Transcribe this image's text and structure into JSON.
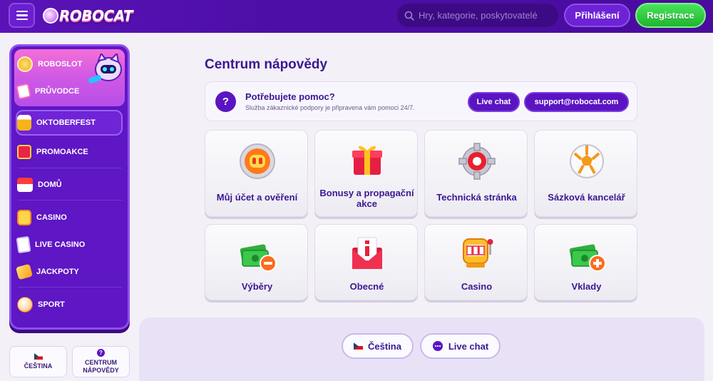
{
  "brand": {
    "logo_text": "ROBOCAT"
  },
  "header": {
    "search_placeholder": "Hry, kategorie, poskytovatelé",
    "login_label": "Přihlášení",
    "register_label": "Registrace"
  },
  "sidebar": {
    "items": [
      {
        "label": "ROBOSLOT",
        "icon": "coin-stack-icon"
      },
      {
        "label": "PRŮVODCE",
        "icon": "guide-book-icon"
      },
      {
        "label": "OKTOBERFEST",
        "icon": "beer-mug-icon"
      },
      {
        "label": "PROMOAKCE",
        "icon": "gift-icon"
      },
      {
        "label": "DOMŮ",
        "icon": "home-icon"
      },
      {
        "label": "CASINO",
        "icon": "slot-machine-icon"
      },
      {
        "label": "LIVE CASINO",
        "icon": "cards-icon"
      },
      {
        "label": "JACKPOTY",
        "icon": "jackpot-icon"
      },
      {
        "label": "SPORT",
        "icon": "ball-icon"
      }
    ],
    "language_label": "ČEŠTINA",
    "help_center_label": "CENTRUM NÁPOVĚDY"
  },
  "main": {
    "title": "Centrum nápovědy",
    "help": {
      "title": "Potřebujete pomoc?",
      "subtitle": "Služba zákaznické podpory je připravena vám pomoci 24/7.",
      "live_chat_label": "Live chat",
      "email_label": "support@robocat.com"
    },
    "categories": [
      {
        "label": "Můj účet a ověření",
        "icon": "account-icon"
      },
      {
        "label": "Bonusy a propagační akce",
        "icon": "gift-box-icon"
      },
      {
        "label": "Technická stránka",
        "icon": "gear-icon"
      },
      {
        "label": "Sázková kancelář",
        "icon": "football-icon"
      },
      {
        "label": "Výběry",
        "icon": "cash-minus-icon"
      },
      {
        "label": "Obecné",
        "icon": "info-envelope-icon"
      },
      {
        "label": "Casino",
        "icon": "slot-machine-icon"
      },
      {
        "label": "Vklady",
        "icon": "cash-plus-icon"
      }
    ]
  },
  "footer": {
    "language_label": "Čeština",
    "live_chat_label": "Live chat"
  },
  "colors": {
    "header_bg": "#4c0ea6",
    "accent_purple": "#5a14c2",
    "register_green": "#2ac83c",
    "title_text": "#3b1792"
  }
}
